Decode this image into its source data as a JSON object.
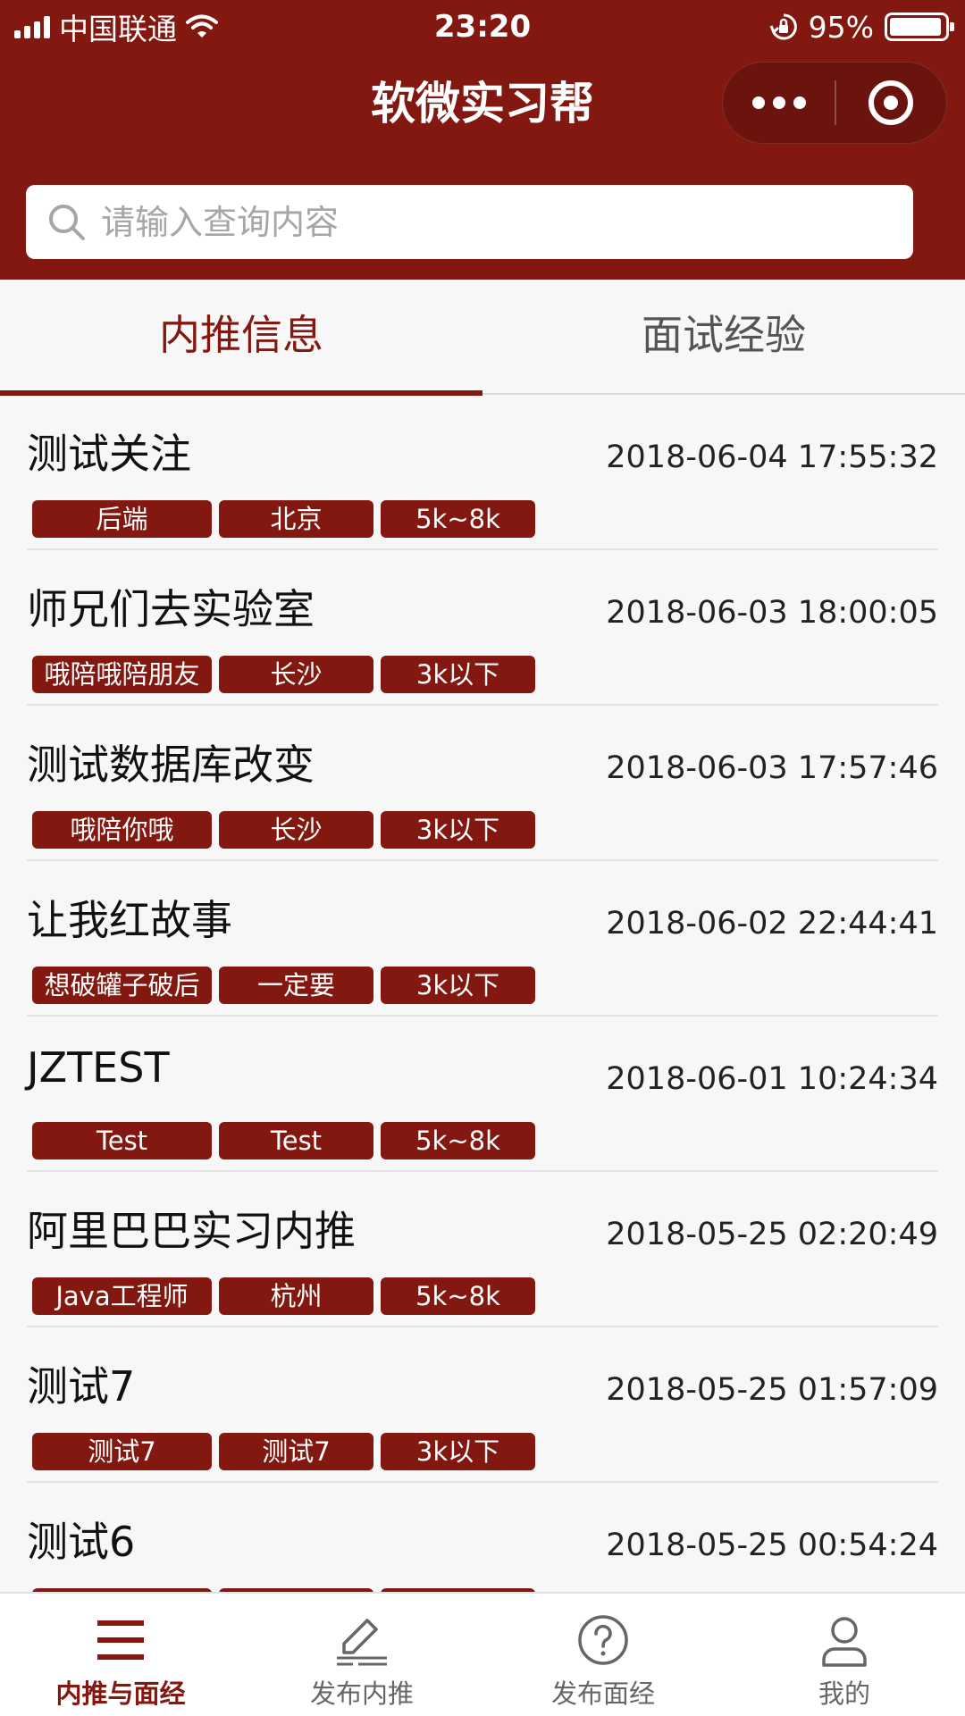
{
  "status_bar": {
    "carrier": "中国联通",
    "time": "23:20",
    "battery_percent": "95%",
    "battery_level": 0.95
  },
  "nav": {
    "title": "软微实习帮"
  },
  "search": {
    "placeholder": "请输入查询内容"
  },
  "tabs": [
    {
      "label": "内推信息",
      "active": true
    },
    {
      "label": "面试经验",
      "active": false
    }
  ],
  "list": [
    {
      "title": "测试关注",
      "time": "2018-06-04 17:55:32",
      "tags": [
        "后端",
        "北京",
        "5k~8k"
      ]
    },
    {
      "title": "师兄们去实验室",
      "time": "2018-06-03 18:00:05",
      "tags": [
        "哦陪哦陪朋友",
        "长沙",
        "3k以下"
      ]
    },
    {
      "title": "测试数据库改变",
      "time": "2018-06-03 17:57:46",
      "tags": [
        "哦陪你哦",
        "长沙",
        "3k以下"
      ]
    },
    {
      "title": "让我红故事",
      "time": "2018-06-02 22:44:41",
      "tags": [
        "想破罐子破后",
        "一定要",
        "3k以下"
      ]
    },
    {
      "title": "JZTEST",
      "time": "2018-06-01 10:24:34",
      "tags": [
        "Test",
        "Test",
        "5k~8k"
      ]
    },
    {
      "title": "阿里巴巴实习内推",
      "time": "2018-05-25 02:20:49",
      "tags": [
        "Java工程师",
        "杭州",
        "5k~8k"
      ]
    },
    {
      "title": "测试7",
      "time": "2018-05-25 01:57:09",
      "tags": [
        "测试7",
        "测试7",
        "3k以下"
      ]
    },
    {
      "title": "测试6",
      "time": "2018-05-25 00:54:24",
      "tags": [
        "",
        "",
        ""
      ]
    }
  ],
  "tabbar": [
    {
      "label": "内推与面经",
      "icon": "list-icon",
      "active": true
    },
    {
      "label": "发布内推",
      "icon": "edit-icon",
      "active": false
    },
    {
      "label": "发布面经",
      "icon": "question-icon",
      "active": false
    },
    {
      "label": "我的",
      "icon": "user-icon",
      "active": false
    }
  ],
  "colors": {
    "brand": "#831811",
    "background": "#f7f7f7"
  }
}
